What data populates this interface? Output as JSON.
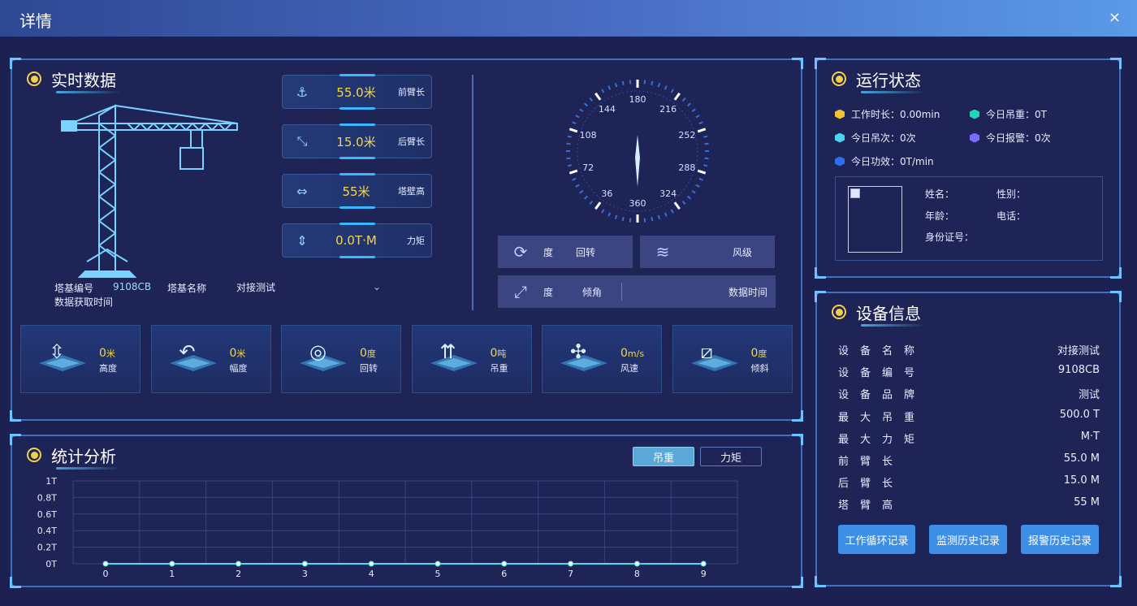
{
  "window": {
    "title": "详情",
    "close_glyph": "×"
  },
  "realtime": {
    "title": "实时数据",
    "metrics": [
      {
        "icon": "hook-icon",
        "glyph": "⚓",
        "value": "55.0米",
        "label": "前臂长"
      },
      {
        "icon": "rear-arm-icon",
        "glyph": "⤡",
        "value": "15.0米",
        "label": "后臂长"
      },
      {
        "icon": "width-icon",
        "glyph": "⇔",
        "value": "55米",
        "label": "塔壁高"
      },
      {
        "icon": "moment-icon",
        "glyph": "⇕",
        "value": "0.0T·M",
        "label": "力矩"
      }
    ],
    "tower_id_label": "塔基编号",
    "tower_id": "9108CB",
    "tower_name_label": "塔基名称",
    "tower_name": "对接测试",
    "fetch_time_label": "数据获取时间",
    "compass": {
      "labels": [
        "180",
        "216",
        "252",
        "288",
        "324",
        "360",
        "36",
        "72",
        "108",
        "144"
      ],
      "needle_deg": 0
    },
    "readings": {
      "rotate_unit": "度",
      "rotate_label": "回转",
      "wind_label": "风级",
      "tilt_unit": "度",
      "tilt_label": "倾角",
      "data_time_label": "数据时间"
    },
    "stats": [
      {
        "icon": "height-icon",
        "glyph": "⇳",
        "value": "0",
        "unit": "米",
        "label": "高度"
      },
      {
        "icon": "amplitude-icon",
        "glyph": "↶",
        "value": "0",
        "unit": "米",
        "label": "幅度"
      },
      {
        "icon": "rotation-icon",
        "glyph": "◎",
        "value": "0",
        "unit": "度",
        "label": "回转"
      },
      {
        "icon": "lift-weight-icon",
        "glyph": "⇈",
        "value": "0",
        "unit": "吨",
        "label": "吊重"
      },
      {
        "icon": "fan-icon",
        "glyph": "✣",
        "value": "0",
        "unit": "m/s",
        "label": "风速"
      },
      {
        "icon": "tilt-icon",
        "glyph": "⧄",
        "value": "0",
        "unit": "度",
        "label": "倾斜"
      }
    ]
  },
  "status": {
    "title": "运行状态",
    "items": [
      {
        "label": "工作时长：0.00min",
        "color": "#f2c230"
      },
      {
        "label": "今日吊重：0T",
        "color": "#1ed6b0"
      },
      {
        "label": "今日吊次：0次",
        "color": "#4fd3f0"
      },
      {
        "label": "今日报警：0次",
        "color": "#7a6cff"
      },
      {
        "label": "今日功效：0T/min",
        "color": "#2f6ef0"
      }
    ],
    "person": {
      "name": "姓名：",
      "gender": "性别：",
      "age": "年龄：",
      "phone": "电话：",
      "id_card": "身份证号："
    }
  },
  "device": {
    "title": "设备信息",
    "rows": [
      {
        "k": "设备名称",
        "v": "对接测试"
      },
      {
        "k": "设备编号",
        "v": "9108CB"
      },
      {
        "k": "设备品牌",
        "v": "测试"
      },
      {
        "k": "最大吊重",
        "v": "500.0 T"
      },
      {
        "k": "最大力矩",
        "v": "M·T"
      },
      {
        "k": "前臂长",
        "v": "55.0 M"
      },
      {
        "k": "后臂长",
        "v": "15.0 M"
      },
      {
        "k": "塔臂高",
        "v": "55 M"
      }
    ],
    "buttons": [
      "工作循环记录",
      "监测历史记录",
      "报警历史记录"
    ]
  },
  "analysis": {
    "title": "统计分析",
    "tabs": [
      {
        "label": "吊重",
        "active": true
      },
      {
        "label": "力矩",
        "active": false
      }
    ]
  },
  "chart_data": {
    "type": "line",
    "x": [
      0,
      1,
      2,
      3,
      4,
      5,
      6,
      7,
      8,
      9
    ],
    "y_ticks": [
      "0T",
      "0.2T",
      "0.4T",
      "0.6T",
      "0.8T",
      "1T"
    ],
    "ylim": [
      0,
      1
    ],
    "series": [
      {
        "values": [
          0,
          0,
          0,
          0,
          0,
          0,
          0,
          0,
          0,
          0
        ]
      }
    ],
    "color": "#3fe0ef",
    "grid": true
  }
}
